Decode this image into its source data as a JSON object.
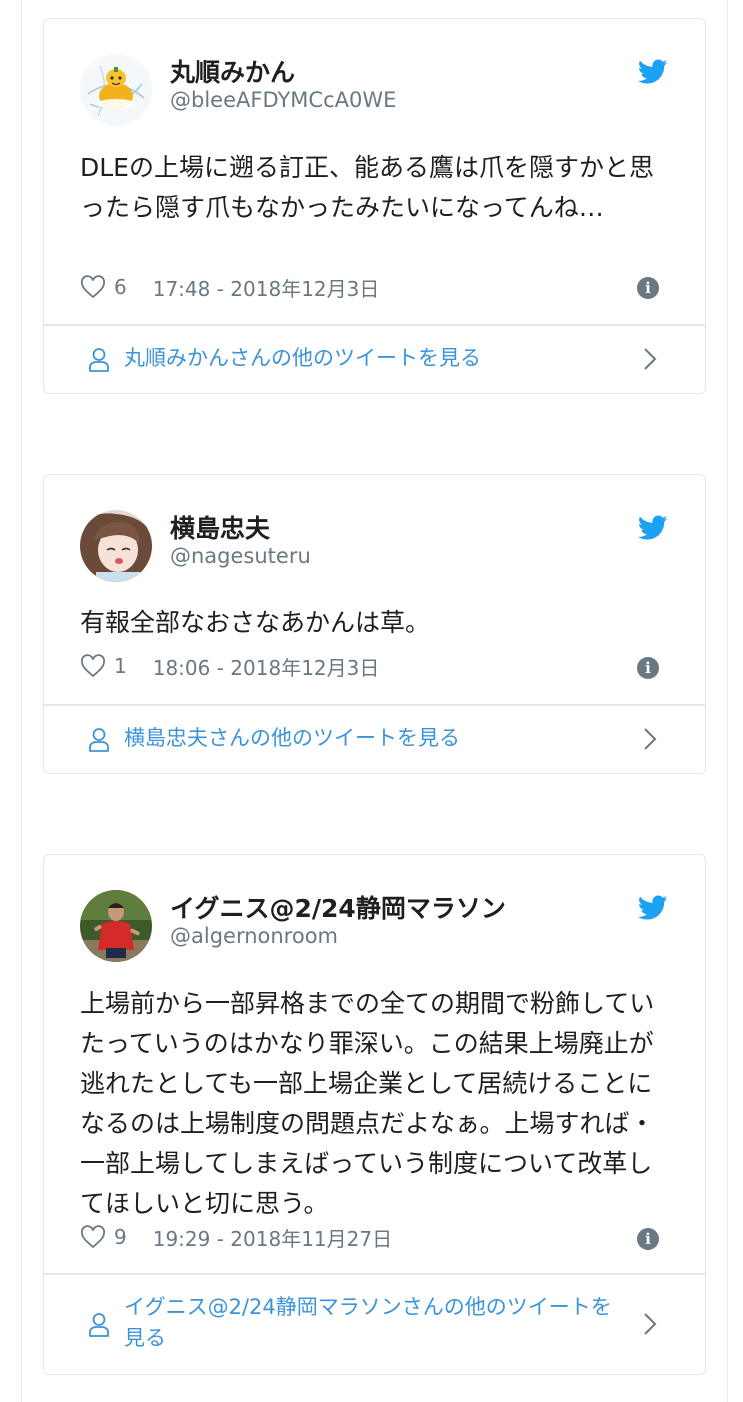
{
  "tweets": [
    {
      "name": "丸順みかん",
      "handle": "@bleeAFDYMCcA0WE",
      "text": "DLEの上場に遡る訂正、能ある鷹は爪を隠すかと思ったら隠す爪もなかったみたいになってんね…",
      "likes": "6",
      "timestamp": "17:48 - 2018年12月3日",
      "more_label": "丸順みかんさんの他のツイートを見る",
      "avatar_icon": "mikan-character-avatar"
    },
    {
      "name": "横島忠夫",
      "handle": "@nagesuteru",
      "text": "有報全部なおさなあかんは草。",
      "likes": "1",
      "timestamp": "18:06 - 2018年12月3日",
      "more_label": "横島忠夫さんの他のツイートを見る",
      "avatar_icon": "anime-girl-avatar"
    },
    {
      "name": "イグニス@2/24静岡マラソン",
      "handle": "@algernonroom",
      "text": "上場前から一部昇格までの全ての期間で粉飾していたっていうのはかなり罪深い。この結果上場廃止が逃れたとしても一部上場企業として居続けることになるのは上場制度の問題点だよなぁ。上場すれば・一部上場してしまえばっていう制度について改革してほしいと切に思う。",
      "likes": "9",
      "timestamp": "19:29 - 2018年11月27日",
      "more_label": "イグニス@2/24静岡マラソンさんの他のツイートを見る",
      "avatar_icon": "runner-photo-avatar"
    }
  ],
  "icons": {
    "brand": "twitter-bird-icon",
    "like": "heart-icon",
    "info": "info-icon",
    "user": "person-icon",
    "arrow": "chevron-right-icon"
  },
  "colors": {
    "twitter_blue": "#1da1f2",
    "link_blue": "#3b94d9",
    "meta_gray": "#697882",
    "border": "#e1e8ed"
  }
}
